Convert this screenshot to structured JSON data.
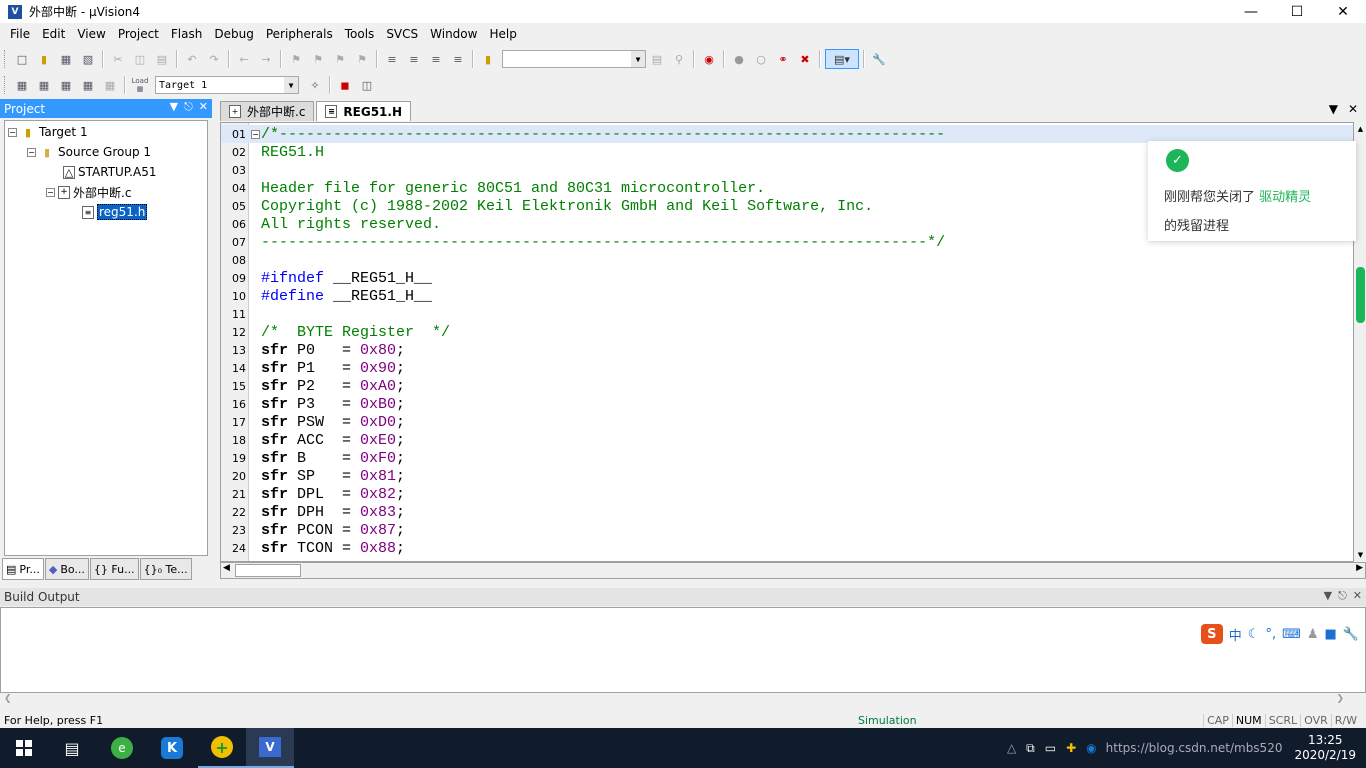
{
  "window": {
    "title": "外部中断  - µVision4",
    "app_icon_letter": "V"
  },
  "menu": [
    "File",
    "Edit",
    "View",
    "Project",
    "Flash",
    "Debug",
    "Peripherals",
    "Tools",
    "SVCS",
    "Window",
    "Help"
  ],
  "toolbar2": {
    "target_combo": "Target 1",
    "load_label": "Load"
  },
  "project_panel": {
    "title": "Project",
    "tree": {
      "target": "Target 1",
      "group": "Source Group 1",
      "startup": "STARTUP.A51",
      "source": "外部中断.c",
      "header": "reg51.h"
    },
    "tabs": [
      "Pr...",
      "Bo...",
      "{} Fu...",
      "{}₀ Te..."
    ]
  },
  "editor": {
    "tabs": [
      "外部中断.c",
      "REG51.H"
    ],
    "lines": [
      {
        "n": "01",
        "t": "/*--------------------------------------------------------------------------",
        "c": "c-cmt"
      },
      {
        "n": "02",
        "t": "REG51.H",
        "c": "c-cmt"
      },
      {
        "n": "03",
        "t": "",
        "c": "c-cmt"
      },
      {
        "n": "04",
        "t": "Header file for generic 80C51 and 80C31 microcontroller.",
        "c": "c-cmt"
      },
      {
        "n": "05",
        "t": "Copyright (c) 1988-2002 Keil Elektronik GmbH and Keil Software, Inc.",
        "c": "c-cmt"
      },
      {
        "n": "06",
        "t": "All rights reserved.",
        "c": "c-cmt"
      },
      {
        "n": "07",
        "t": "--------------------------------------------------------------------------*/",
        "c": "c-cmt"
      },
      {
        "n": "08",
        "t": "",
        "c": ""
      },
      {
        "n": "09",
        "t": "#ifndef __REG51_H__",
        "c": "pp"
      },
      {
        "n": "10",
        "t": "#define __REG51_H__",
        "c": "pp"
      },
      {
        "n": "11",
        "t": "",
        "c": ""
      },
      {
        "n": "12",
        "t": "/*  BYTE Register  */",
        "c": "c-cmt"
      },
      {
        "n": "13",
        "kw": "sfr",
        "name": " P0   = ",
        "val": "0x80",
        "end": ";"
      },
      {
        "n": "14",
        "kw": "sfr",
        "name": " P1   = ",
        "val": "0x90",
        "end": ";"
      },
      {
        "n": "15",
        "kw": "sfr",
        "name": " P2   = ",
        "val": "0xA0",
        "end": ";"
      },
      {
        "n": "16",
        "kw": "sfr",
        "name": " P3   = ",
        "val": "0xB0",
        "end": ";"
      },
      {
        "n": "17",
        "kw": "sfr",
        "name": " PSW  = ",
        "val": "0xD0",
        "end": ";"
      },
      {
        "n": "18",
        "kw": "sfr",
        "name": " ACC  = ",
        "val": "0xE0",
        "end": ";"
      },
      {
        "n": "19",
        "kw": "sfr",
        "name": " B    = ",
        "val": "0xF0",
        "end": ";"
      },
      {
        "n": "20",
        "kw": "sfr",
        "name": " SP   = ",
        "val": "0x81",
        "end": ";"
      },
      {
        "n": "21",
        "kw": "sfr",
        "name": " DPL  = ",
        "val": "0x82",
        "end": ";"
      },
      {
        "n": "22",
        "kw": "sfr",
        "name": " DPH  = ",
        "val": "0x83",
        "end": ";"
      },
      {
        "n": "23",
        "kw": "sfr",
        "name": " PCON = ",
        "val": "0x87",
        "end": ";"
      },
      {
        "n": "24",
        "kw": "sfr",
        "name": " TCON = ",
        "val": "0x88",
        "end": ";"
      }
    ]
  },
  "notification": {
    "line1_prefix": "刚刚帮您关闭了 ",
    "line1_highlight": "驱动精灵",
    "line2": "的残留进程"
  },
  "build_output": {
    "title": "Build Output",
    "ime_label": "中"
  },
  "status": {
    "help": "For Help, press F1",
    "mode": "Simulation",
    "indicators": [
      "CAP",
      "NUM",
      "SCRL",
      "OVR",
      "R/W"
    ]
  },
  "taskbar": {
    "time": "13:25",
    "date": "2020/2/19",
    "tray_text": "https://blog.csdn.net/mbs520"
  }
}
